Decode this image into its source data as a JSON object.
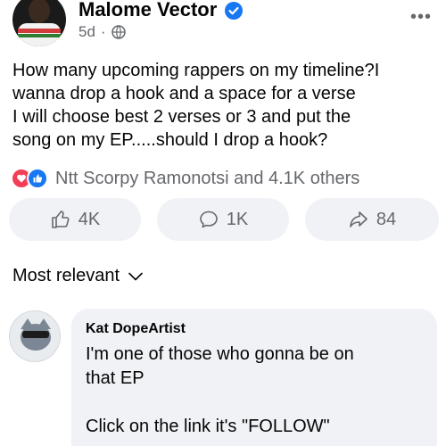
{
  "post": {
    "author": "Malome Vector",
    "time": "5d",
    "separator": "·",
    "text": "How many upcoming rappers on my timeline?I\nwanna drop a hook and a space for a verse\nI will choose best 2 verses or 3 and put the\nsong on my EP.....should I drop a hook?",
    "more": "•••"
  },
  "reactions": {
    "summary": "Ntt Scorpy Ramonotsi and 4.1K others",
    "icons": [
      "love-icon",
      "like-icon"
    ]
  },
  "actions": {
    "like_count": "4K",
    "comment_count": "1K",
    "share_count": "84"
  },
  "sort": {
    "label": "Most relevant"
  },
  "comment": {
    "author": "Kat DopeArtist",
    "text": "I'm one of those who gonna be on\nthat EP\n\nClick on the link it's \"FOLLOW\""
  },
  "colors": {
    "accent": "#1877f2",
    "love": "#f33e58",
    "muted_text": "#65676b",
    "button_bg": "#f0f2f5"
  }
}
